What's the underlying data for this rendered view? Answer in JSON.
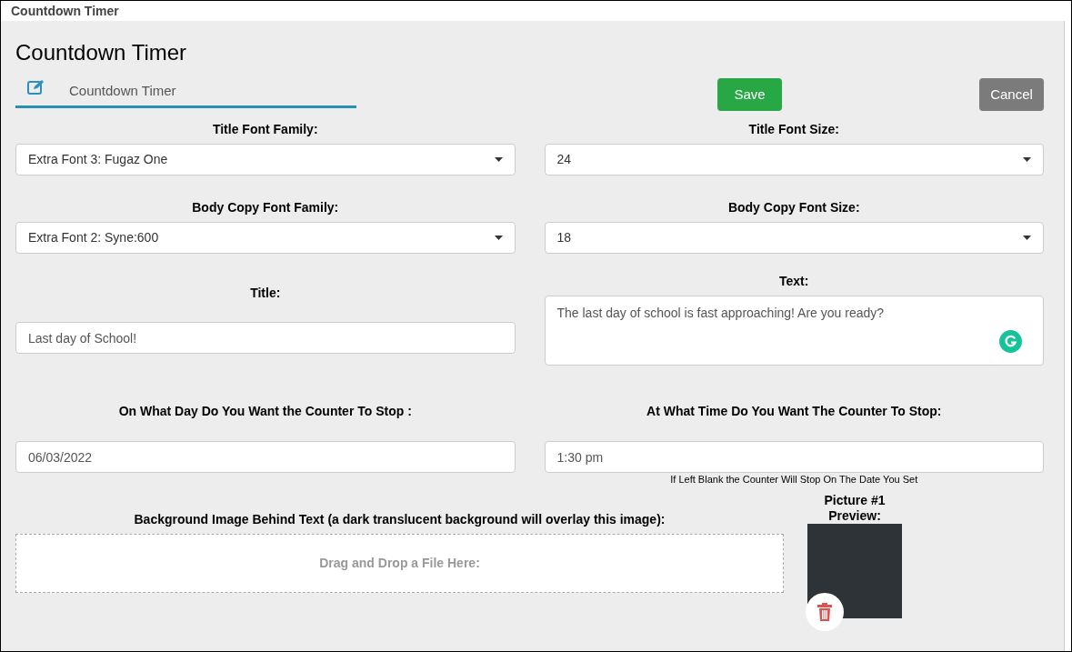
{
  "window": {
    "title": "Countdown Timer"
  },
  "heading": "Countdown Timer",
  "tab": {
    "label": "Countdown Timer",
    "selected": true
  },
  "buttons": [
    {
      "kind": "save",
      "label": "Save"
    },
    {
      "kind": "cancel",
      "label": "Cancel"
    }
  ],
  "rows": [
    [
      {
        "kind": "select",
        "label": "Title Font Family:",
        "value": "Extra Font 3: Fugaz One"
      },
      {
        "kind": "select",
        "label": "Title Font Size:",
        "value": "24"
      }
    ],
    [
      {
        "kind": "select",
        "label": "Body Copy Font Family:",
        "value": "Extra Font 2: Syne:600"
      },
      {
        "kind": "select",
        "label": "Body Copy Font Size:",
        "value": "18"
      }
    ],
    [
      {
        "kind": "input",
        "label": "Title:",
        "value": "Last day of School!"
      },
      {
        "kind": "textarea",
        "label": "Text:",
        "value": "The last day of school is fast approaching! Are you ready?"
      }
    ],
    [
      {
        "kind": "input",
        "label": "On What Day Do You Want the Counter To Stop :",
        "value": "06/03/2022"
      },
      {
        "kind": "input",
        "label": "At What Time Do You Want The Counter To Stop:",
        "value": "1:30 pm",
        "hint": "If Left Blank the Counter Will Stop On The Date You Set"
      }
    ]
  ],
  "upload": {
    "label": "Background Image Behind Text (a dark translucent background will overlay this image):",
    "placeholder": "Drag and Drop a File Here:"
  },
  "preview": {
    "label": "Picture #1 Preview:"
  }
}
